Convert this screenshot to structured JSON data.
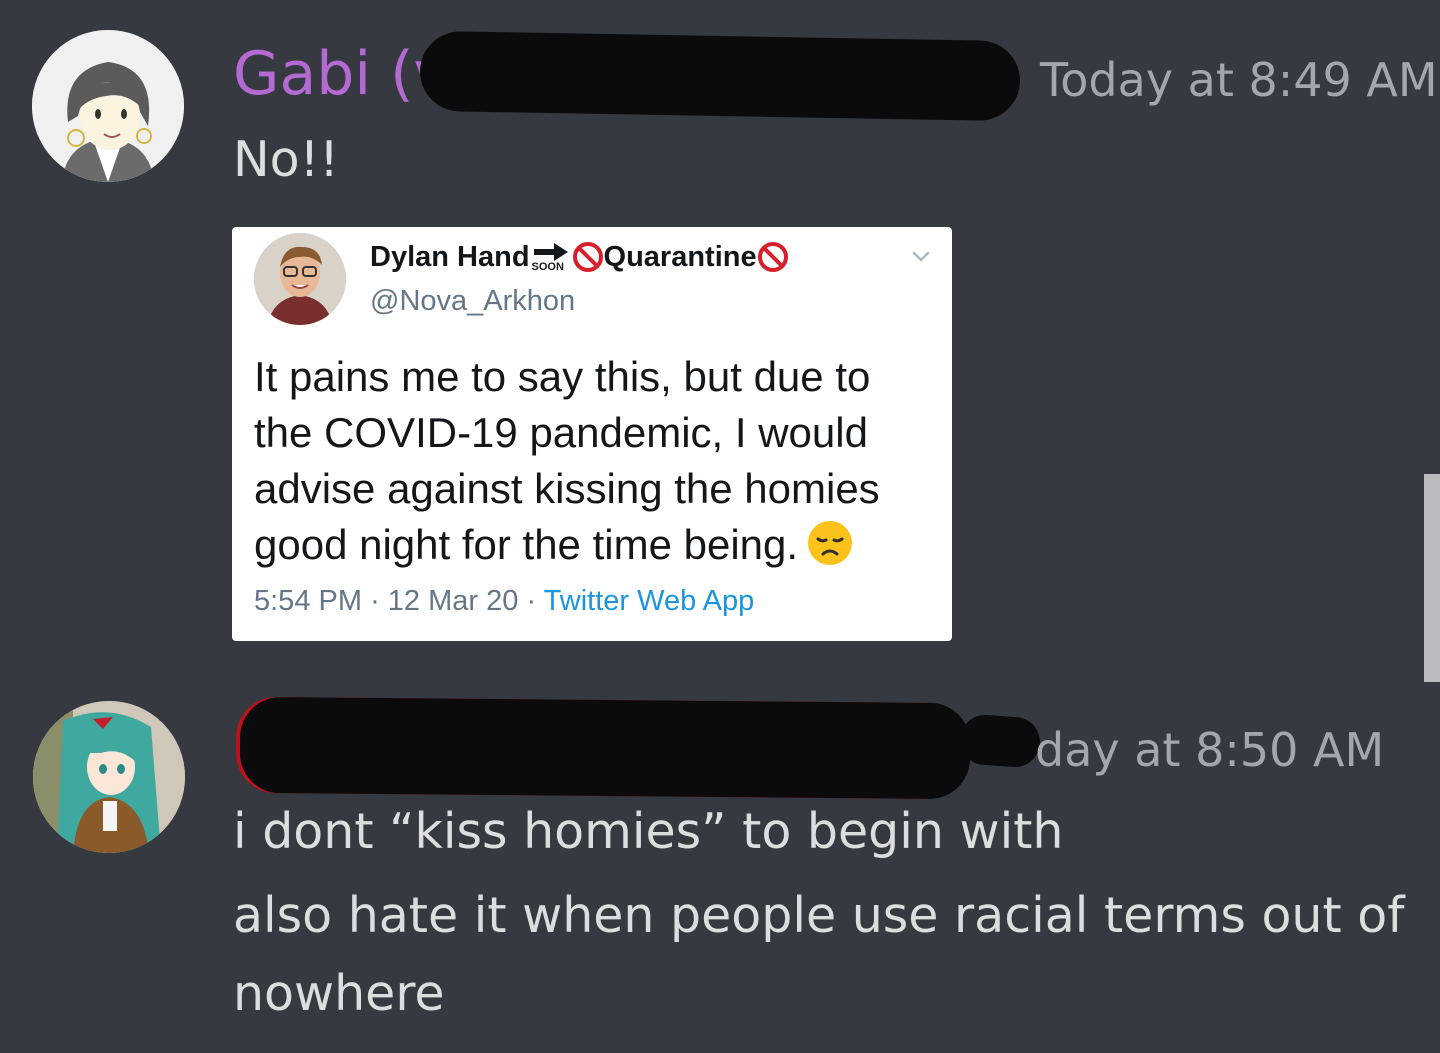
{
  "messages": [
    {
      "username": "Gabi (v",
      "timestamp": "Today at 8:49 AM",
      "lines": [
        "No!!"
      ]
    },
    {
      "username": "",
      "timestamp": "day at 8:50 AM",
      "lines": [
        "i dont “kiss homies” to begin with",
        "also hate it when people use racial terms out of",
        "nowhere"
      ]
    }
  ],
  "tweet": {
    "name": "Dylan Hand",
    "badge": "SOON",
    "name_suffix": "Quarantine",
    "handle": "@Nova_Arkhon",
    "body_lines": [
      "It pains me to say this, but due to",
      "the COVID-19 pandemic, I would",
      "advise against kissing the homies",
      "good night for the time being."
    ],
    "time": "5:54 PM",
    "date": "12 Mar 20",
    "source": "Twitter Web App",
    "separator": "·"
  },
  "colors": {
    "background": "#36393f",
    "username_purple": "#b36ad2",
    "username_red": "#e0141e",
    "link_blue": "#1b95e0"
  },
  "icons": {
    "chevron": "chevron-down-icon",
    "arrow": "right-arrow-icon",
    "prohibited": "no-entry-sign-icon",
    "emoji": "disappointed-face-icon"
  }
}
